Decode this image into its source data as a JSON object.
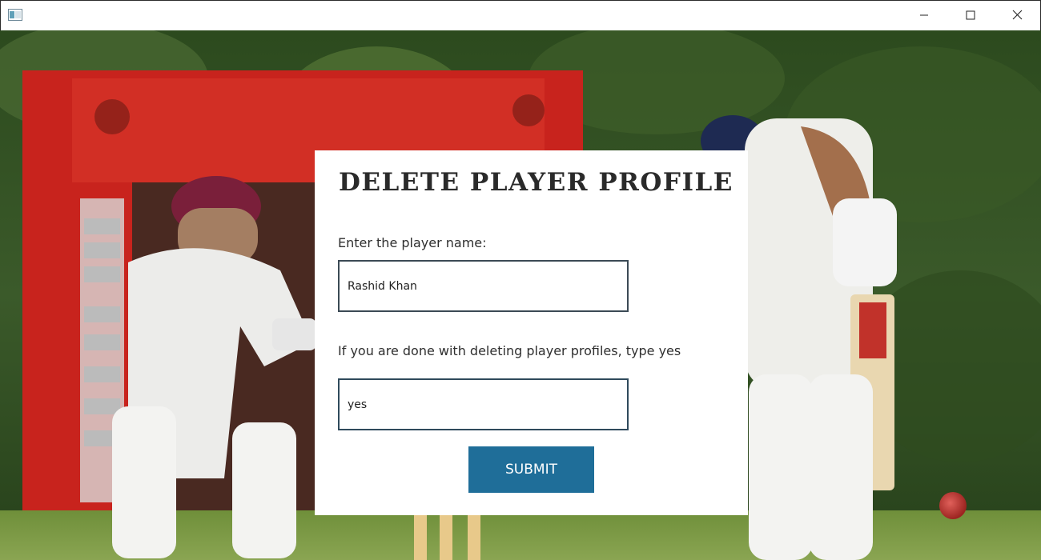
{
  "window": {
    "app_icon": "window-app-icon",
    "controls": {
      "minimize_icon": "minimize-icon",
      "maximize_icon": "maximize-icon",
      "close_icon": "close-icon"
    }
  },
  "background": {
    "description_icon": "cricket-photo-background"
  },
  "form": {
    "title": "DELETE PLAYER PROFILE",
    "player_name_label": "Enter the player name:",
    "player_name_value": "Rashid Khan",
    "done_label": "If you are done with deleting player profiles, type yes",
    "done_value": "yes",
    "submit_label": "SUBMIT"
  },
  "colors": {
    "submit_button": "#1f6e99",
    "panel": "#ffffff",
    "text": "#2f2f2f"
  }
}
